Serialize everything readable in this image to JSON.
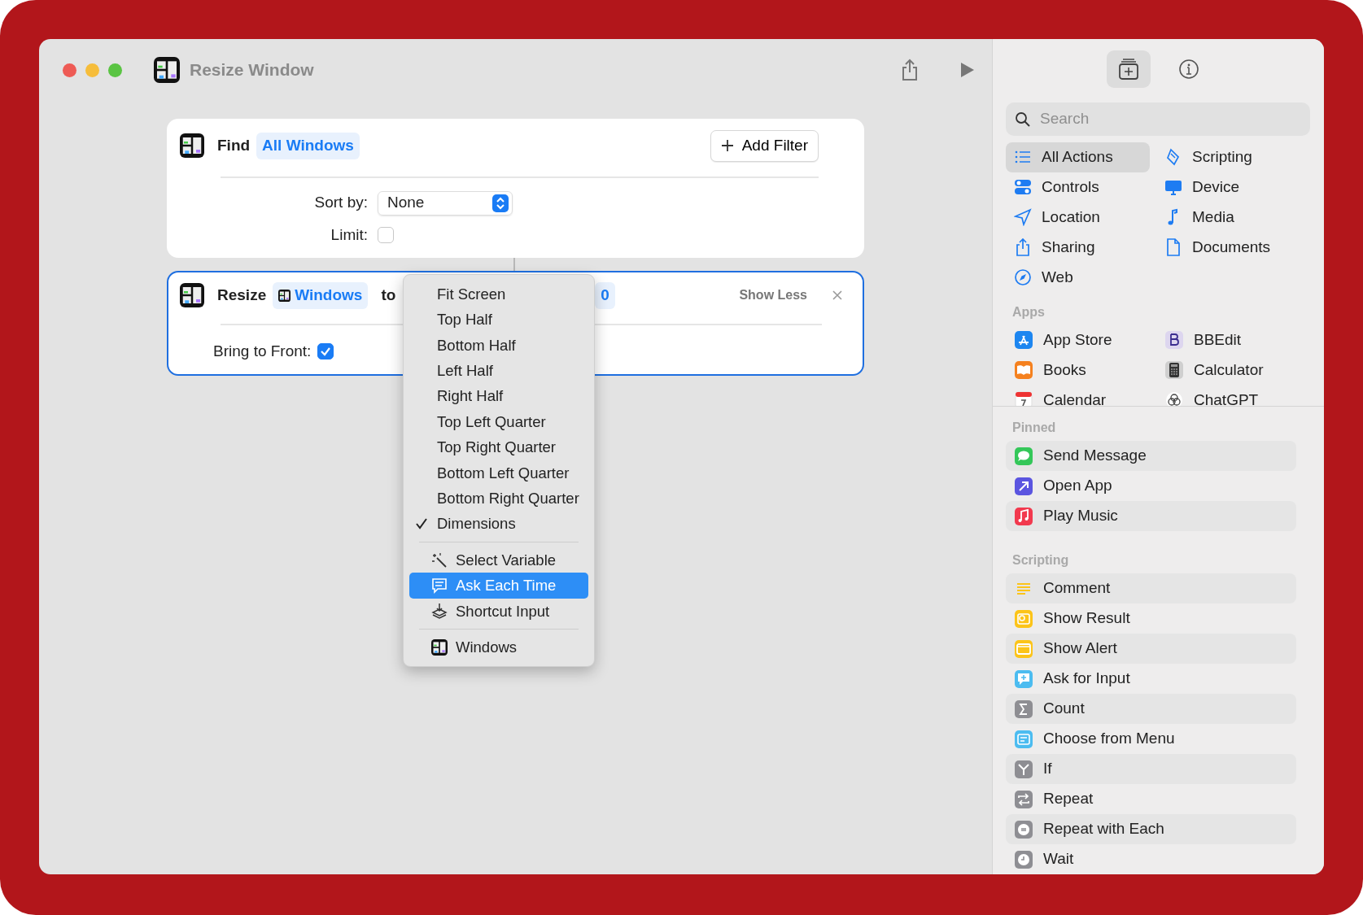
{
  "window": {
    "title": "Resize Window"
  },
  "find_action": {
    "verb": "Find",
    "subject": "All Windows",
    "add_filter": "Add Filter",
    "sort_label": "Sort by:",
    "sort_value": "None",
    "limit_label": "Limit:",
    "limit_checked": false
  },
  "resize_action": {
    "verb": "Resize",
    "subject": "Windows",
    "connector": "to",
    "value": "0",
    "show_less": "Show Less",
    "front_label": "Bring to Front:",
    "front_checked": true
  },
  "menu": {
    "options": [
      {
        "label": "Fit Screen",
        "checked": false
      },
      {
        "label": "Top Half",
        "checked": false
      },
      {
        "label": "Bottom Half",
        "checked": false
      },
      {
        "label": "Left Half",
        "checked": false
      },
      {
        "label": "Right Half",
        "checked": false
      },
      {
        "label": "Top Left Quarter",
        "checked": false
      },
      {
        "label": "Top Right Quarter",
        "checked": false
      },
      {
        "label": "Bottom Left Quarter",
        "checked": false
      },
      {
        "label": "Bottom Right Quarter",
        "checked": false
      },
      {
        "label": "Dimensions",
        "checked": true
      }
    ],
    "variables": [
      {
        "label": "Select Variable",
        "selected": false
      },
      {
        "label": "Ask Each Time",
        "selected": true
      },
      {
        "label": "Shortcut Input",
        "selected": false
      }
    ],
    "sources": [
      {
        "label": "Windows"
      }
    ]
  },
  "sidebar": {
    "panel_buttons": [
      {
        "selected": true
      },
      {
        "selected": false
      }
    ],
    "search": {
      "placeholder": "Search"
    },
    "categories": [
      {
        "label": "All Actions",
        "selected": true
      },
      {
        "label": "Scripting",
        "selected": false
      },
      {
        "label": "Controls",
        "selected": false
      },
      {
        "label": "Device",
        "selected": false
      },
      {
        "label": "Location",
        "selected": false
      },
      {
        "label": "Media",
        "selected": false
      },
      {
        "label": "Sharing",
        "selected": false
      },
      {
        "label": "Documents",
        "selected": false
      },
      {
        "label": "Web",
        "selected": false
      }
    ],
    "apps_heading": "Apps",
    "apps": [
      {
        "label": "App Store"
      },
      {
        "label": "BBEdit"
      },
      {
        "label": "Books"
      },
      {
        "label": "Calculator"
      },
      {
        "label": "Calendar"
      },
      {
        "label": "ChatGPT"
      }
    ],
    "pinned_heading": "Pinned",
    "pinned": [
      {
        "label": "Send Message"
      },
      {
        "label": "Open App"
      },
      {
        "label": "Play Music"
      }
    ],
    "scripting_heading": "Scripting",
    "scripting": [
      {
        "label": "Comment"
      },
      {
        "label": "Show Result"
      },
      {
        "label": "Show Alert"
      },
      {
        "label": "Ask for Input"
      },
      {
        "label": "Count"
      },
      {
        "label": "Choose from Menu"
      },
      {
        "label": "If"
      },
      {
        "label": "Repeat"
      },
      {
        "label": "Repeat with Each"
      },
      {
        "label": "Wait"
      }
    ]
  }
}
